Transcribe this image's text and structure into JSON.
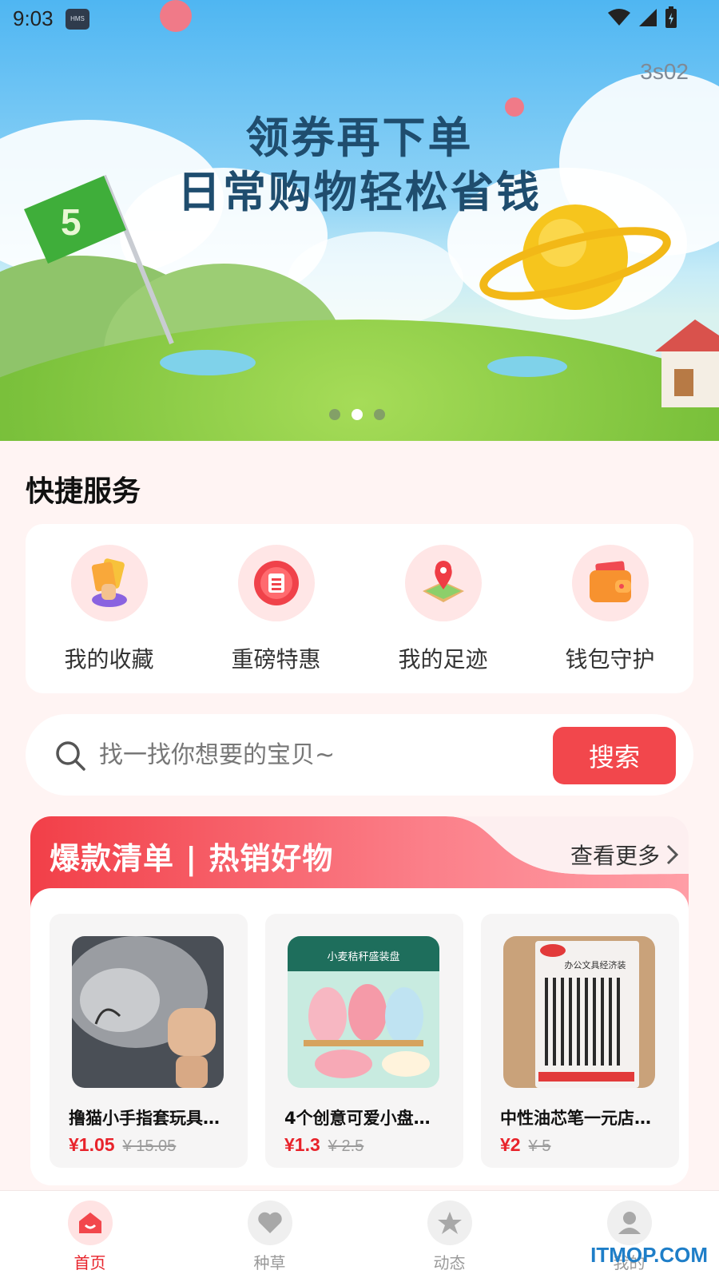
{
  "status_bar": {
    "time": "9:03",
    "badge": "HMS"
  },
  "banner": {
    "timer": "3s02",
    "headline_line1": "领券再下单",
    "headline_line2": "日常购物轻松省钱",
    "flag_number": "5",
    "page_count": 3,
    "active_page": 2
  },
  "quick_services": {
    "title": "快捷服务",
    "items": [
      {
        "label": "我的收藏",
        "icon": "favorite-cards-icon"
      },
      {
        "label": "重磅特惠",
        "icon": "deal-badge-icon"
      },
      {
        "label": "我的足迹",
        "icon": "location-pin-icon"
      },
      {
        "label": "钱包守护",
        "icon": "wallet-icon"
      }
    ]
  },
  "search": {
    "placeholder": "找一找你想要的宝贝~",
    "value": "",
    "button_label": "搜索"
  },
  "hot_list": {
    "title": "爆款清单 | 热销好物",
    "see_more": "查看更多",
    "products": [
      {
        "name": "撸猫小手指套玩具…",
        "price": "¥1.05",
        "original_price": "¥ 15.05",
        "image": "cat-photo"
      },
      {
        "name": "4个创意可爱小盘…",
        "price": "¥1.3",
        "original_price": "¥ 2.5",
        "image": "plates-photo",
        "image_text": "小麦秸秆盛装盘"
      },
      {
        "name": "中性油芯笔一元店…",
        "price": "¥2",
        "original_price": "¥ 5",
        "image": "pens-photo",
        "image_text": "办公文具经济装"
      }
    ]
  },
  "tab_bar": {
    "tabs": [
      {
        "label": "首页",
        "icon": "home-icon",
        "active": true
      },
      {
        "label": "种草",
        "icon": "heart-icon",
        "active": false
      },
      {
        "label": "动态",
        "icon": "star-icon",
        "active": false
      },
      {
        "label": "我的",
        "icon": "user-icon",
        "active": false
      }
    ]
  },
  "watermark": "ITMOP.COM",
  "colors": {
    "accent_red": "#f2474c",
    "price_red": "#e8232b",
    "page_bg": "#fff4f3"
  }
}
